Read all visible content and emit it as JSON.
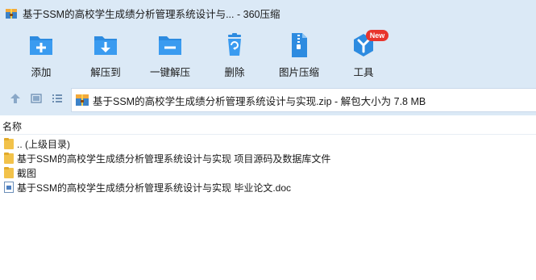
{
  "window": {
    "title": "基于SSM的高校学生成绩分析管理系统设计与... - 360压缩"
  },
  "toolbar": {
    "add": "添加",
    "extract_to": "解压到",
    "one_click_extract": "一键解压",
    "delete": "删除",
    "image_compress": "图片压缩",
    "tools": "工具",
    "new_badge": "New"
  },
  "address": {
    "text": "基于SSM的高校学生成绩分析管理系统设计与实现.zip - 解包大小为 7.8 MB"
  },
  "columns": {
    "name": "名称"
  },
  "files": [
    {
      "name": ".. (上级目录)",
      "type": "folder"
    },
    {
      "name": "基于SSM的高校学生成绩分析管理系统设计与实现 项目源码及数据库文件",
      "type": "folder"
    },
    {
      "name": "截图",
      "type": "folder"
    },
    {
      "name": "基于SSM的高校学生成绩分析管理系统设计与实现 毕业论文.doc",
      "type": "doc"
    }
  ],
  "colors": {
    "chrome_bg": "#dbe9f6",
    "icon_blue": "#2d8be0",
    "folder_yellow": "#f2c24a",
    "badge_red": "#e8352d"
  }
}
